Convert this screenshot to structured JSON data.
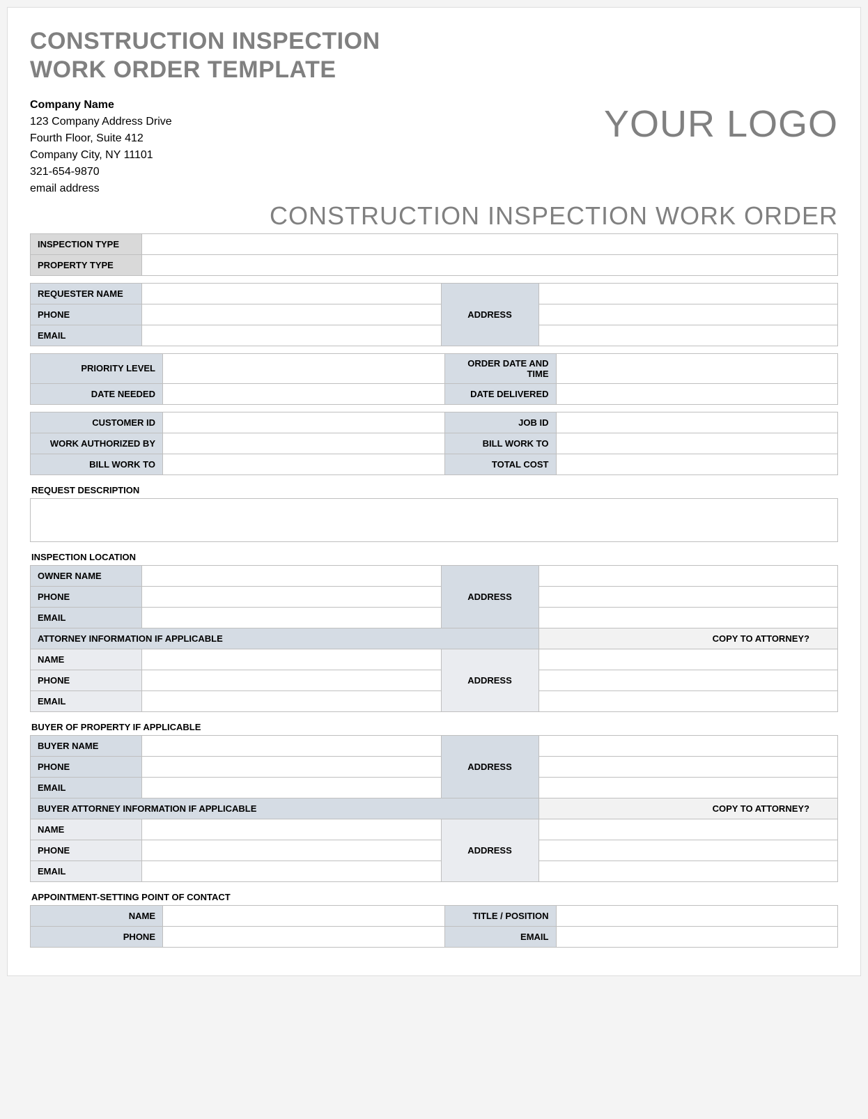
{
  "title_line1": "CONSTRUCTION INSPECTION",
  "title_line2": "WORK ORDER TEMPLATE",
  "company": {
    "name": "Company Name",
    "addr1": "123 Company Address Drive",
    "addr2": "Fourth Floor, Suite 412",
    "addr3": "Company City, NY  11101",
    "phone": "321-654-9870",
    "email": "email address"
  },
  "logo_text": "YOUR LOGO",
  "sub_header": "CONSTRUCTION INSPECTION WORK ORDER",
  "labels": {
    "inspection_type": "INSPECTION TYPE",
    "property_type": "PROPERTY TYPE",
    "requester_name": "REQUESTER NAME",
    "phone": "PHONE",
    "email": "EMAIL",
    "address": "ADDRESS",
    "priority_level": "PRIORITY LEVEL",
    "order_date_time": "ORDER DATE AND TIME",
    "date_needed": "DATE NEEDED",
    "date_delivered": "DATE DELIVERED",
    "customer_id": "CUSTOMER ID",
    "job_id": "JOB ID",
    "work_auth_by": "WORK AUTHORIZED BY",
    "bill_work_to": "BILL WORK TO",
    "total_cost": "TOTAL COST",
    "request_description": "REQUEST DESCRIPTION",
    "inspection_location": "INSPECTION LOCATION",
    "owner_name": "OWNER NAME",
    "attorney_info": "ATTORNEY INFORMATION IF APPLICABLE",
    "copy_to_attorney": "COPY TO ATTORNEY?",
    "name": "NAME",
    "buyer_of_property": "BUYER OF PROPERTY IF APPLICABLE",
    "buyer_name": "BUYER NAME",
    "buyer_attorney_info": "BUYER ATTORNEY INFORMATION IF APPLICABLE",
    "appointment_contact": "APPOINTMENT-SETTING POINT OF CONTACT",
    "title_position": "TITLE / POSITION"
  }
}
